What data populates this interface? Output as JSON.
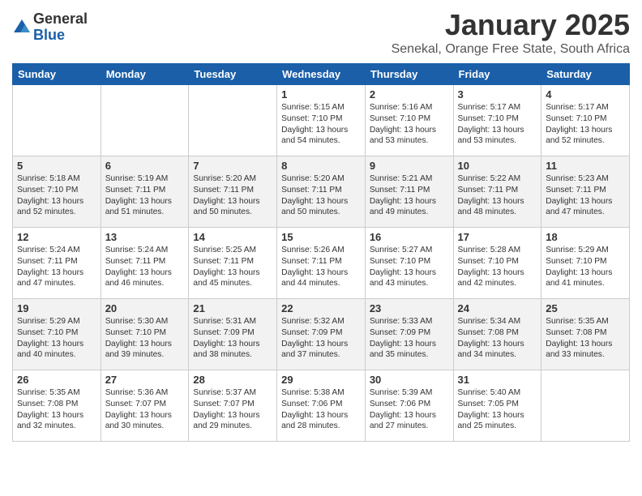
{
  "logo": {
    "general": "General",
    "blue": "Blue"
  },
  "title": "January 2025",
  "subtitle": "Senekal, Orange Free State, South Africa",
  "days_of_week": [
    "Sunday",
    "Monday",
    "Tuesday",
    "Wednesday",
    "Thursday",
    "Friday",
    "Saturday"
  ],
  "weeks": [
    [
      {
        "day": "",
        "empty": true
      },
      {
        "day": "",
        "empty": true
      },
      {
        "day": "",
        "empty": true
      },
      {
        "day": "1",
        "sunrise": "5:15 AM",
        "sunset": "7:10 PM",
        "daylight": "13 hours and 54 minutes."
      },
      {
        "day": "2",
        "sunrise": "5:16 AM",
        "sunset": "7:10 PM",
        "daylight": "13 hours and 53 minutes."
      },
      {
        "day": "3",
        "sunrise": "5:17 AM",
        "sunset": "7:10 PM",
        "daylight": "13 hours and 53 minutes."
      },
      {
        "day": "4",
        "sunrise": "5:17 AM",
        "sunset": "7:10 PM",
        "daylight": "13 hours and 52 minutes."
      }
    ],
    [
      {
        "day": "5",
        "sunrise": "5:18 AM",
        "sunset": "7:10 PM",
        "daylight": "13 hours and 52 minutes."
      },
      {
        "day": "6",
        "sunrise": "5:19 AM",
        "sunset": "7:11 PM",
        "daylight": "13 hours and 51 minutes."
      },
      {
        "day": "7",
        "sunrise": "5:20 AM",
        "sunset": "7:11 PM",
        "daylight": "13 hours and 50 minutes."
      },
      {
        "day": "8",
        "sunrise": "5:20 AM",
        "sunset": "7:11 PM",
        "daylight": "13 hours and 50 minutes."
      },
      {
        "day": "9",
        "sunrise": "5:21 AM",
        "sunset": "7:11 PM",
        "daylight": "13 hours and 49 minutes."
      },
      {
        "day": "10",
        "sunrise": "5:22 AM",
        "sunset": "7:11 PM",
        "daylight": "13 hours and 48 minutes."
      },
      {
        "day": "11",
        "sunrise": "5:23 AM",
        "sunset": "7:11 PM",
        "daylight": "13 hours and 47 minutes."
      }
    ],
    [
      {
        "day": "12",
        "sunrise": "5:24 AM",
        "sunset": "7:11 PM",
        "daylight": "13 hours and 47 minutes."
      },
      {
        "day": "13",
        "sunrise": "5:24 AM",
        "sunset": "7:11 PM",
        "daylight": "13 hours and 46 minutes."
      },
      {
        "day": "14",
        "sunrise": "5:25 AM",
        "sunset": "7:11 PM",
        "daylight": "13 hours and 45 minutes."
      },
      {
        "day": "15",
        "sunrise": "5:26 AM",
        "sunset": "7:11 PM",
        "daylight": "13 hours and 44 minutes."
      },
      {
        "day": "16",
        "sunrise": "5:27 AM",
        "sunset": "7:10 PM",
        "daylight": "13 hours and 43 minutes."
      },
      {
        "day": "17",
        "sunrise": "5:28 AM",
        "sunset": "7:10 PM",
        "daylight": "13 hours and 42 minutes."
      },
      {
        "day": "18",
        "sunrise": "5:29 AM",
        "sunset": "7:10 PM",
        "daylight": "13 hours and 41 minutes."
      }
    ],
    [
      {
        "day": "19",
        "sunrise": "5:29 AM",
        "sunset": "7:10 PM",
        "daylight": "13 hours and 40 minutes."
      },
      {
        "day": "20",
        "sunrise": "5:30 AM",
        "sunset": "7:10 PM",
        "daylight": "13 hours and 39 minutes."
      },
      {
        "day": "21",
        "sunrise": "5:31 AM",
        "sunset": "7:09 PM",
        "daylight": "13 hours and 38 minutes."
      },
      {
        "day": "22",
        "sunrise": "5:32 AM",
        "sunset": "7:09 PM",
        "daylight": "13 hours and 37 minutes."
      },
      {
        "day": "23",
        "sunrise": "5:33 AM",
        "sunset": "7:09 PM",
        "daylight": "13 hours and 35 minutes."
      },
      {
        "day": "24",
        "sunrise": "5:34 AM",
        "sunset": "7:08 PM",
        "daylight": "13 hours and 34 minutes."
      },
      {
        "day": "25",
        "sunrise": "5:35 AM",
        "sunset": "7:08 PM",
        "daylight": "13 hours and 33 minutes."
      }
    ],
    [
      {
        "day": "26",
        "sunrise": "5:35 AM",
        "sunset": "7:08 PM",
        "daylight": "13 hours and 32 minutes."
      },
      {
        "day": "27",
        "sunrise": "5:36 AM",
        "sunset": "7:07 PM",
        "daylight": "13 hours and 30 minutes."
      },
      {
        "day": "28",
        "sunrise": "5:37 AM",
        "sunset": "7:07 PM",
        "daylight": "13 hours and 29 minutes."
      },
      {
        "day": "29",
        "sunrise": "5:38 AM",
        "sunset": "7:06 PM",
        "daylight": "13 hours and 28 minutes."
      },
      {
        "day": "30",
        "sunrise": "5:39 AM",
        "sunset": "7:06 PM",
        "daylight": "13 hours and 27 minutes."
      },
      {
        "day": "31",
        "sunrise": "5:40 AM",
        "sunset": "7:05 PM",
        "daylight": "13 hours and 25 minutes."
      },
      {
        "day": "",
        "empty": true
      }
    ]
  ]
}
